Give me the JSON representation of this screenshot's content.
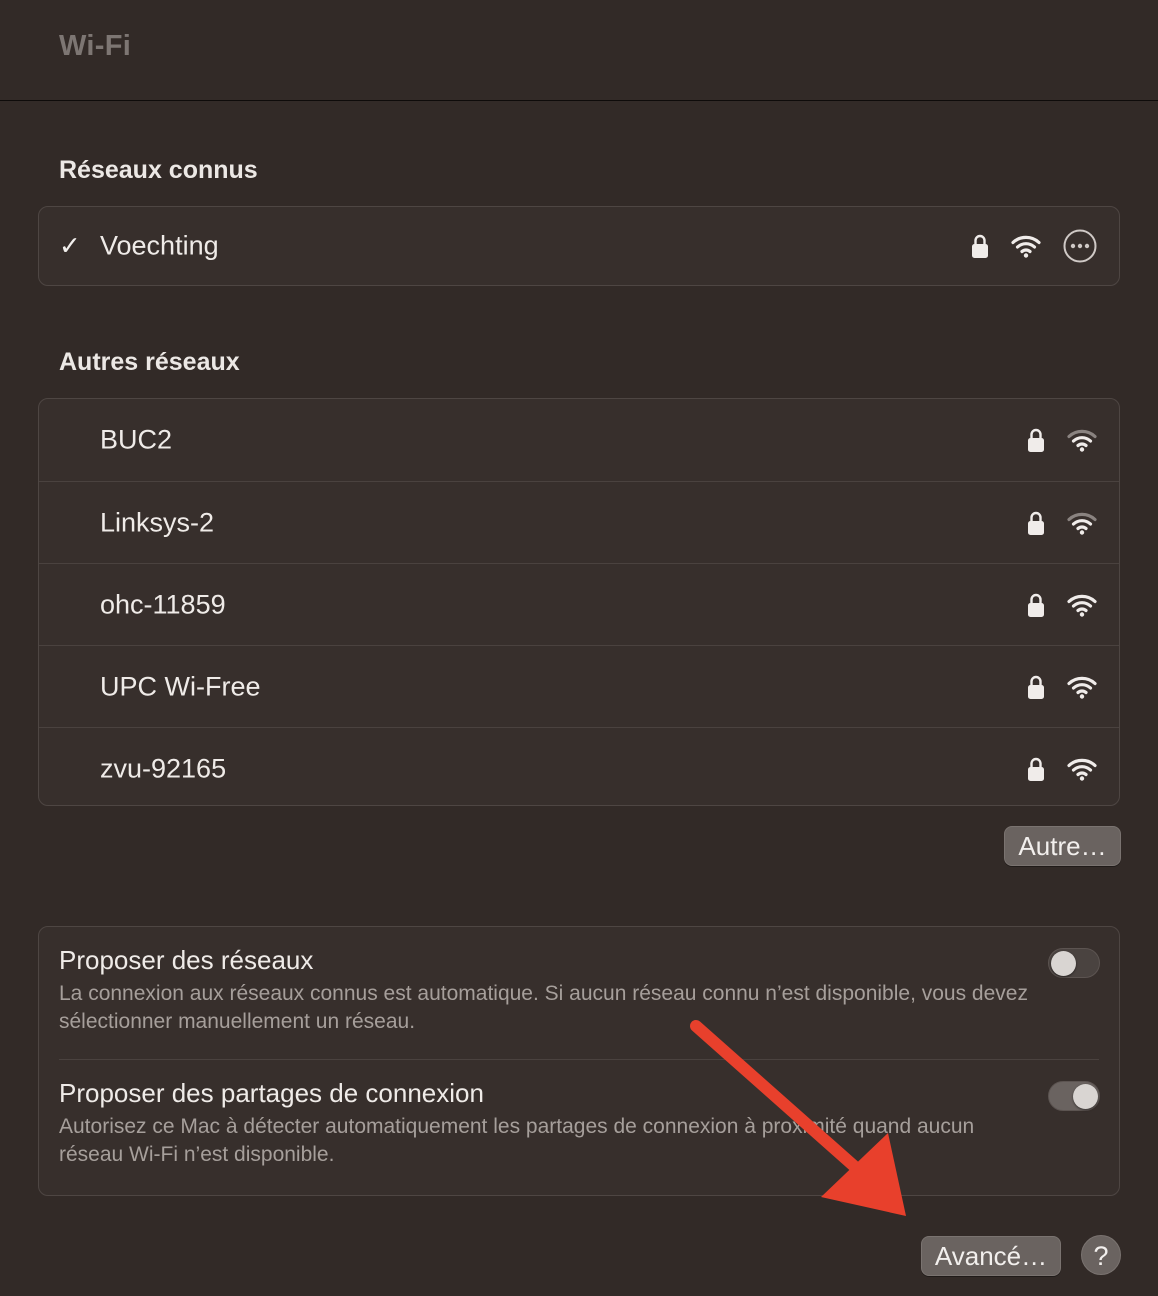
{
  "window": {
    "title": "Wi-Fi"
  },
  "known_networks": {
    "heading": "Réseaux connus",
    "items": [
      {
        "name": "Voechting",
        "connected": true,
        "check": "✓",
        "secured": true,
        "icons": [
          "lock-icon",
          "wifi-icon",
          "more-options-icon"
        ]
      }
    ]
  },
  "other_networks": {
    "heading": "Autres réseaux",
    "items": [
      {
        "name": "BUC2",
        "secured": true,
        "signal": "medium"
      },
      {
        "name": "Linksys-2",
        "secured": true,
        "signal": "medium"
      },
      {
        "name": "ohc-11859",
        "secured": true,
        "signal": "full"
      },
      {
        "name": "UPC Wi-Free",
        "secured": true,
        "signal": "full"
      },
      {
        "name": "zvu-92165",
        "secured": true,
        "signal": "full"
      }
    ],
    "other_button": "Autre…"
  },
  "options": [
    {
      "title": "Proposer des réseaux",
      "description": "La connexion aux réseaux connus est automatique. Si aucun réseau connu n’est disponible, vous devez sélectionner manuellement un réseau.",
      "enabled": false
    },
    {
      "title": "Proposer des partages de connexion",
      "description": "Autorisez ce Mac à détecter automatiquement les partages de connexion à proximité quand aucun réseau Wi-Fi n’est disponible.",
      "enabled": true
    }
  ],
  "footer": {
    "advanced_button": "Avancé…",
    "help_button": "?"
  },
  "colors": {
    "background": "#322a27",
    "panel": "#372f2c",
    "annotation_arrow": "#e8402c"
  }
}
